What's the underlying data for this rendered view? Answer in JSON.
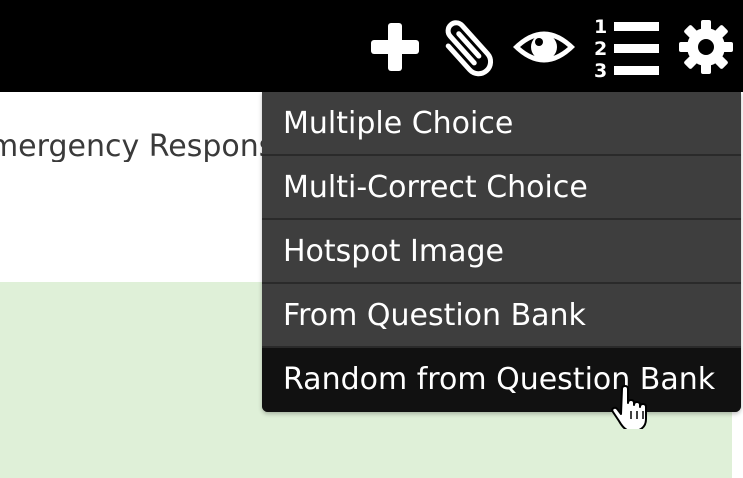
{
  "toolbar": {
    "icons": [
      {
        "name": "add-icon",
        "label": "add"
      },
      {
        "name": "attach-icon",
        "label": "paperclip"
      },
      {
        "name": "preview-icon",
        "label": "eye"
      },
      {
        "name": "numbered-list-icon",
        "label": "numbered list"
      },
      {
        "name": "settings-icon",
        "label": "gear"
      }
    ]
  },
  "document": {
    "title_fragment": "Emergency Response P"
  },
  "add_menu": {
    "items": [
      {
        "label": "Multiple Choice"
      },
      {
        "label": "Multi-Correct Choice"
      },
      {
        "label": "Hotspot Image"
      },
      {
        "label": "From Question Bank"
      },
      {
        "label": "Random from Question Bank"
      }
    ],
    "hovered_index": 4
  },
  "colors": {
    "topbar": "#000000",
    "menu_bg": "#3e3e3e",
    "menu_hover": "#111111",
    "menu_text": "#ffffff",
    "green_panel": "#dff0d8"
  }
}
